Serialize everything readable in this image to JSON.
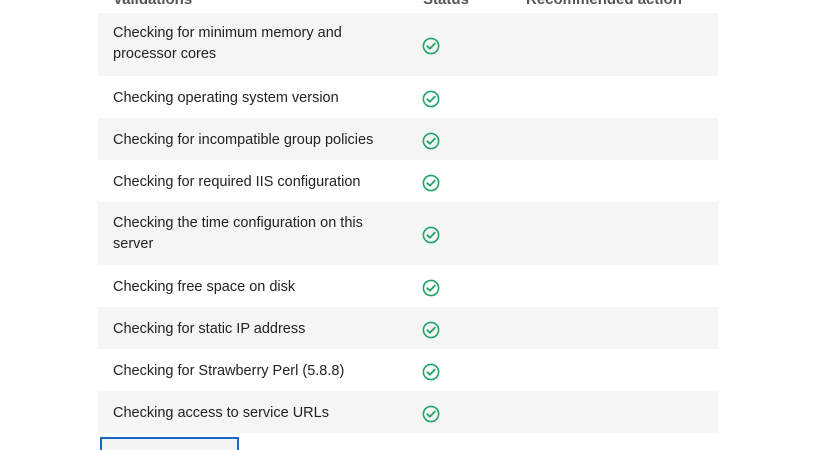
{
  "table": {
    "headers": {
      "validations": "Validations",
      "status": "Status",
      "action": "Recommended action"
    },
    "rows": [
      {
        "label": "Checking for minimum memory and processor cores",
        "status": "passed",
        "action": ""
      },
      {
        "label": "Checking operating system version",
        "status": "passed",
        "action": ""
      },
      {
        "label": "Checking for incompatible group policies",
        "status": "passed",
        "action": ""
      },
      {
        "label": "Checking for required IIS configuration",
        "status": "passed",
        "action": ""
      },
      {
        "label": "Checking the time configuration on this server",
        "status": "passed",
        "action": ""
      },
      {
        "label": "Checking free space on disk",
        "status": "passed",
        "action": ""
      },
      {
        "label": "Checking for static IP address",
        "status": "passed",
        "action": ""
      },
      {
        "label": "Checking for Strawberry Perl (5.8.8)",
        "status": "passed",
        "action": ""
      },
      {
        "label": "Checking access to service URLs",
        "status": "passed",
        "action": ""
      }
    ]
  },
  "icons": {
    "status_passed": "check-circle-icon"
  },
  "colors": {
    "success": "#21a366",
    "row_shade": "#f5f5f5",
    "focus_border": "#1a66c2"
  }
}
